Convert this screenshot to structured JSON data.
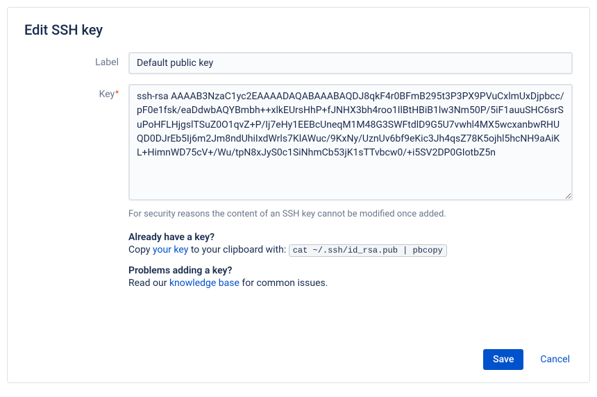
{
  "modal": {
    "title": "Edit SSH key",
    "labels": {
      "label_field": "Label",
      "key_field": "Key"
    },
    "fields": {
      "label_value": "Default public key",
      "key_value": "ssh-rsa AAAAB3NzaC1yc2EAAAADAQABAAABAQDJ8qkF4r0BFmB295t3P3PX9PVuCxlmUxDjpbcc/pF0e1fsk/eaDdwbAQYBmbh++xlkEUrsHhP+fJNHX3bh4roo1IlBtHBiB1lw3Nm50P/5iF1auuSHC6srSuPoHFLHjgslTSuZ0O1qvZ+P/Ij7eHy1EEBcUneqM1M48G3SWFtdlD9G5U7vwhl4MX5wcxanbwRHUQD0DJrEb5Ij6m2Jm8ndUhiIxdWrls7KlAWuc/9KxNy/UznUv6bf9eKic3Jh4qsZ78K5ojhl5hcNH9aAiKL+HimnWD75cV+/Wu/tpN8xJyS0c1SiNhmCb53jK1sTTvbcw0/+i5SV2DP0GIotbZ5n"
    },
    "help_text": "For security reasons the content of an SSH key cannot be modified once added.",
    "info": {
      "heading1": "Already have a key?",
      "line1_prefix": "Copy ",
      "line1_link": "your key",
      "line1_mid": " to your clipboard with: ",
      "line1_code": "cat ~/.ssh/id_rsa.pub | pbcopy",
      "heading2": "Problems adding a key?",
      "line2_prefix": "Read our ",
      "line2_link": "knowledge base",
      "line2_suffix": " for common issues."
    },
    "buttons": {
      "save": "Save",
      "cancel": "Cancel"
    }
  }
}
